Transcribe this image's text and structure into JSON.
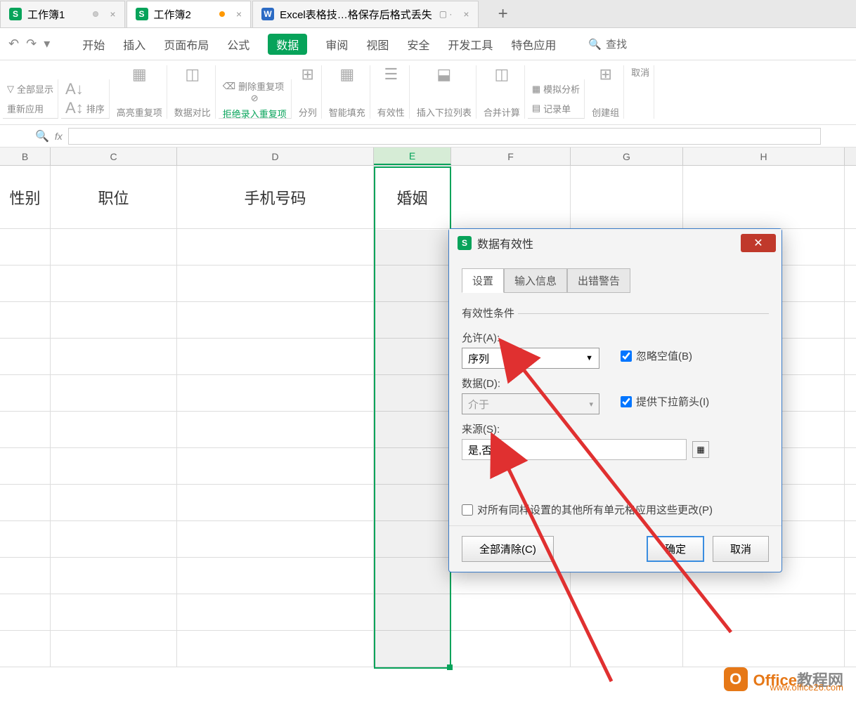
{
  "tabs": [
    {
      "label": "工作簿1",
      "icon": "S",
      "dot": "grey"
    },
    {
      "label": "工作簿2",
      "icon": "S",
      "dot": "orange",
      "active": true
    },
    {
      "label": "Excel表格技…格保存后格式丢失",
      "icon": "W",
      "blue": true
    }
  ],
  "menu": [
    "开始",
    "插入",
    "页面布局",
    "公式",
    "数据",
    "审阅",
    "视图",
    "安全",
    "开发工具",
    "特色应用"
  ],
  "menu_active": "数据",
  "search_label": "查找",
  "ribbon": {
    "group1_a": "全部显示",
    "group1_b": "重新应用",
    "sort": "排序",
    "highlight": "高亮重复项",
    "compare": "数据对比",
    "del_dup": "删除重复项",
    "reject_dup": "拒绝录入重复项",
    "split": "分列",
    "fill": "智能填充",
    "validity": "有效性",
    "insert_dd": "插入下拉列表",
    "merge": "合并计算",
    "record": "记录单",
    "simulate": "模拟分析",
    "group": "创建组",
    "ungroup": "取消"
  },
  "columns": {
    "B": "B",
    "C": "C",
    "D": "D",
    "E": "E",
    "F": "F",
    "G": "G",
    "H": "H"
  },
  "headers": {
    "B": "性别",
    "C": "职位",
    "D": "手机号码",
    "E": "婚姻"
  },
  "dialog": {
    "title": "数据有效性",
    "tabs": [
      "设置",
      "输入信息",
      "出错警告"
    ],
    "fieldset": "有效性条件",
    "allow_label": "允许(A):",
    "allow_value": "序列",
    "data_label": "数据(D):",
    "data_value": "介于",
    "source_label": "来源(S):",
    "source_value": "是,否",
    "ignore_blank": "忽略空值(B)",
    "dropdown": "提供下拉箭头(I)",
    "apply_all": "对所有同样设置的其他所有单元格应用这些更改(P)",
    "clear": "全部清除(C)",
    "ok": "确定",
    "cancel": "取消"
  },
  "watermark": {
    "title1": "Office",
    "title2": "教程网",
    "url": "www.office26.com",
    "icon": "O"
  }
}
